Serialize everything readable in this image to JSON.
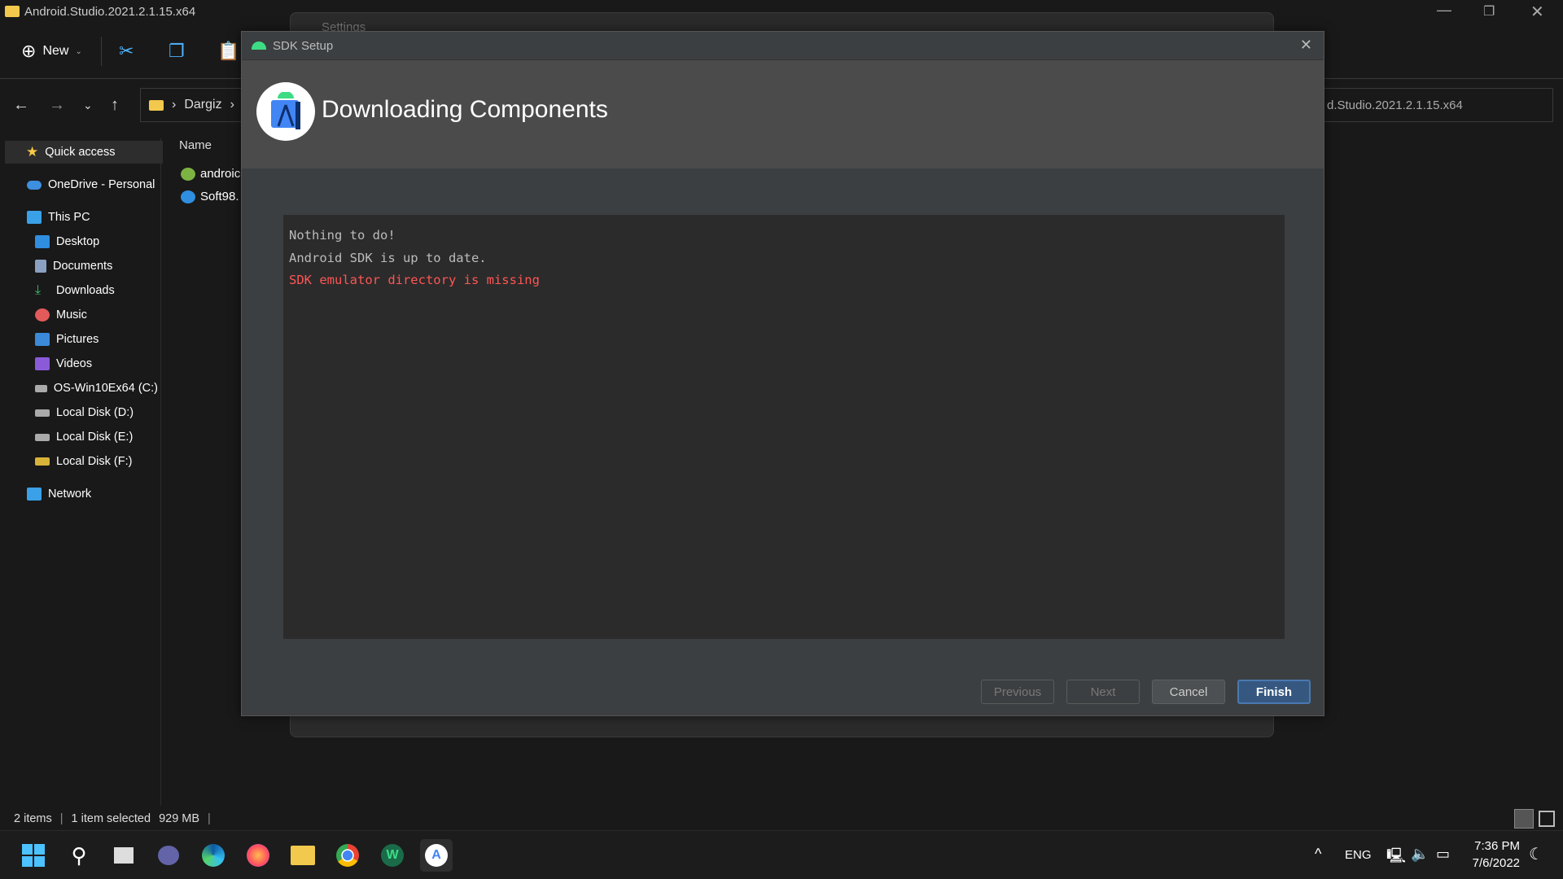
{
  "explorer": {
    "title": "Android.Studio.2021.2.1.15.x64",
    "toolbar": {
      "new_label": "New"
    },
    "breadcrumb": [
      "Dargiz"
    ],
    "search_path": "d.Studio.2021.2.1.15.x64",
    "sidebar": {
      "items": [
        {
          "label": "Quick access",
          "icon": "star-icon"
        },
        {
          "label": "OneDrive - Personal",
          "icon": "cloud-icon"
        },
        {
          "label": "This PC",
          "icon": "pc-icon"
        },
        {
          "label": "Desktop",
          "icon": "desktop-icon"
        },
        {
          "label": "Documents",
          "icon": "documents-icon"
        },
        {
          "label": "Downloads",
          "icon": "downloads-icon"
        },
        {
          "label": "Music",
          "icon": "music-icon"
        },
        {
          "label": "Pictures",
          "icon": "pictures-icon"
        },
        {
          "label": "Videos",
          "icon": "videos-icon"
        },
        {
          "label": "OS-Win10Ex64 (C:)",
          "icon": "drive-icon"
        },
        {
          "label": "Local Disk (D:)",
          "icon": "drive-icon"
        },
        {
          "label": "Local Disk (E:)",
          "icon": "drive-icon"
        },
        {
          "label": "Local Disk (F:)",
          "icon": "drive-lock-icon"
        },
        {
          "label": "Network",
          "icon": "network-icon"
        }
      ]
    },
    "column_name": "Name",
    "files": [
      "androic",
      "Soft98."
    ],
    "status": {
      "items": "2 items",
      "selected": "1 item selected",
      "size": "929 MB"
    }
  },
  "settings_dialog": {
    "title": "Settings"
  },
  "sdk_dialog": {
    "title": "SDK Setup",
    "heading": "Downloading Components",
    "console": [
      {
        "text": "Nothing to do!",
        "type": "info"
      },
      {
        "text": "Android SDK is up to date.",
        "type": "info"
      },
      {
        "text": "SDK emulator directory is missing",
        "type": "error"
      }
    ],
    "buttons": {
      "previous": "Previous",
      "next": "Next",
      "cancel": "Cancel",
      "finish": "Finish"
    },
    "colors": {
      "error": "#ff5555",
      "primary": "#365880"
    }
  },
  "taskbar": {
    "apps": [
      "start",
      "search",
      "task-view",
      "teams",
      "edge",
      "firefox",
      "file-explorer",
      "chrome",
      "winrar",
      "android-studio"
    ],
    "language": "ENG",
    "time": "7:36 PM",
    "date": "7/6/2022"
  }
}
